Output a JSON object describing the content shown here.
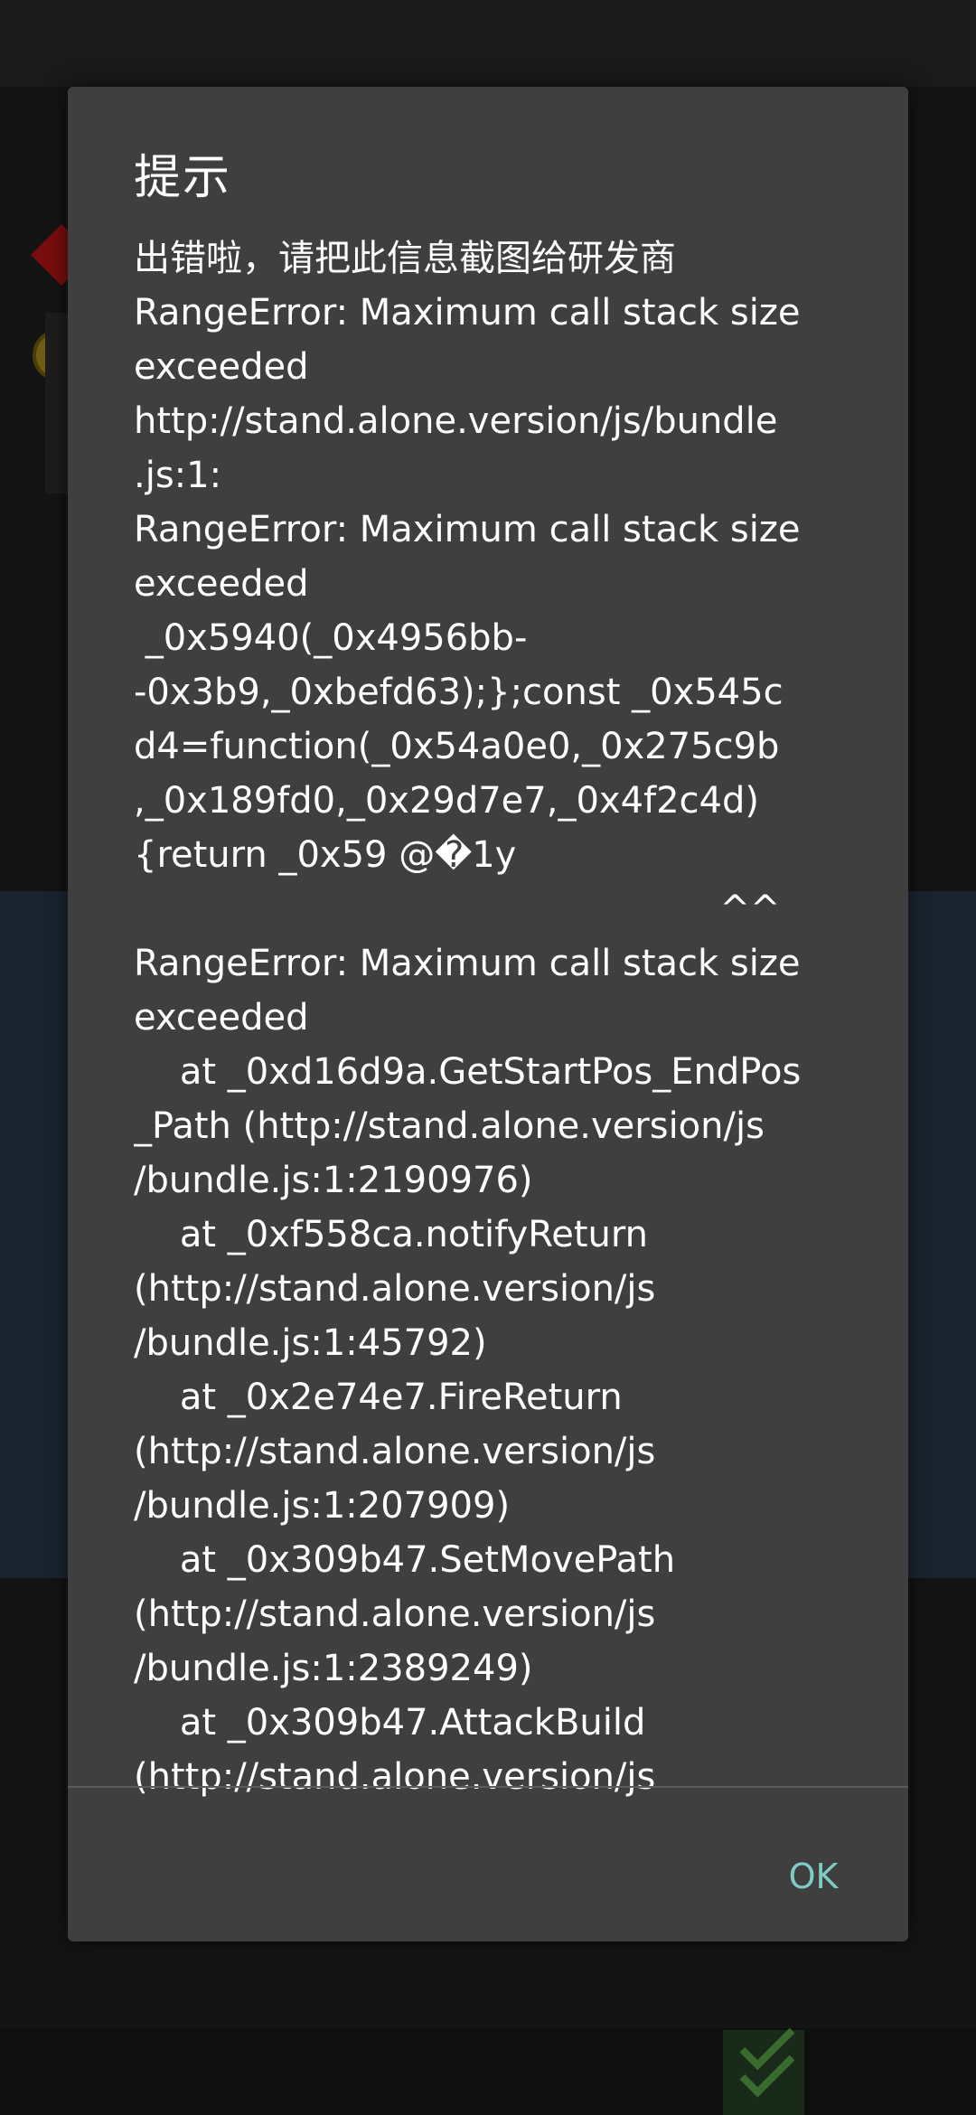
{
  "dialog": {
    "title": "提示",
    "message_lines": [
      "出错啦，请把此信息截图给研发商",
      "RangeError: Maximum call stack size",
      "exceeded",
      "http://stand.alone.version/js/bundle",
      ".js:1:",
      "RangeError: Maximum call stack size",
      "exceeded",
      " _0x5940(_0x4956bb-",
      "-0x3b9,_0xbefd63);};const _0x545c",
      "d4=function(_0x54a0e0,_0x275c9b",
      ",_0x189fd0,_0x29d7e7,_0x4f2c4d)",
      "{return _0x59 @�1y",
      "                                                   ^^",
      "RangeError: Maximum call stack size",
      "exceeded",
      "    at _0xd16d9a.GetStartPos_EndPos",
      "_Path (http://stand.alone.version/js",
      "/bundle.js:1:2190976)",
      "    at _0xf558ca.notifyReturn",
      "(http://stand.alone.version/js",
      "/bundle.js:1:45792)",
      "    at _0x2e74e7.FireReturn",
      "(http://stand.alone.version/js",
      "/bundle.js:1:207909)",
      "    at _0x309b47.SetMovePath",
      "(http://stand.alone.version/js",
      "/bundle.js:1:2389249)",
      "    at _0x309b47.AttackBuild",
      "(http://stand.alone.version/js"
    ],
    "ok_label": "OK"
  }
}
